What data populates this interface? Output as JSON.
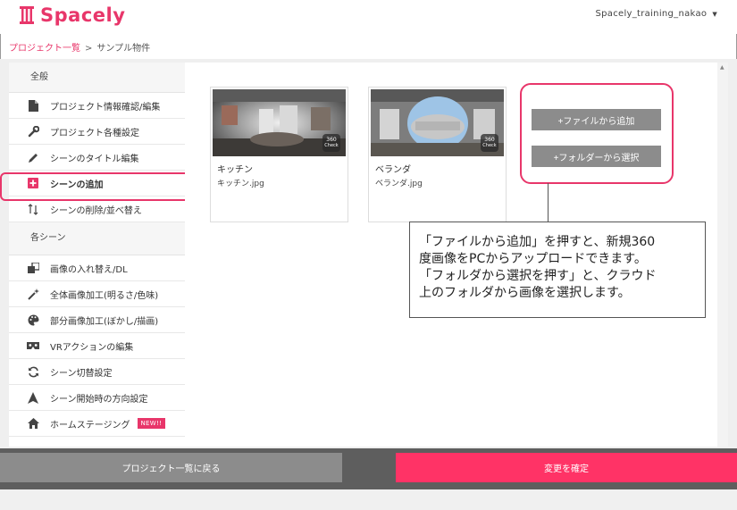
{
  "app": {
    "logo_text": "Spacely",
    "user_name": "Spacely_training_nakao"
  },
  "breadcrumb": {
    "root": "プロジェクト一覧",
    "separator": ">",
    "current": "サンプル物件"
  },
  "sidebar": {
    "general_heading": "全般",
    "general_items": [
      {
        "label": "プロジェクト情報確認/編集",
        "icon": "document-icon"
      },
      {
        "label": "プロジェクト各種設定",
        "icon": "wrench-icon"
      },
      {
        "label": "シーンのタイトル編集",
        "icon": "pencil-icon"
      },
      {
        "label": "シーンの追加",
        "icon": "plus-square-icon"
      },
      {
        "label": "シーンの削除/並べ替え",
        "icon": "sort-arrows-icon"
      }
    ],
    "scene_heading": "各シーン",
    "scene_items": [
      {
        "label": "画像の入れ替え/DL",
        "icon": "image-swap-icon"
      },
      {
        "label": "全体画像加工(明るさ/色味)",
        "icon": "magic-wand-icon"
      },
      {
        "label": "部分画像加工(ぼかし/描画)",
        "icon": "palette-icon"
      },
      {
        "label": "VRアクションの編集",
        "icon": "vr-goggles-icon"
      },
      {
        "label": "シーン切替設定",
        "icon": "refresh-icon"
      },
      {
        "label": "シーン開始時の方向設定",
        "icon": "direction-arrow-icon"
      },
      {
        "label": "ホームステージング",
        "icon": "home-icon",
        "badge": "NEW!!"
      }
    ]
  },
  "scenes": [
    {
      "title": "キッチン",
      "file": "キッチン.jpg",
      "badge_top": "360",
      "badge_bottom": "Check"
    },
    {
      "title": "ベランダ",
      "file": "ベランダ.jpg",
      "badge_top": "360",
      "badge_bottom": "Check"
    }
  ],
  "actions": {
    "add_file": "+ファイルから追加",
    "add_folder": "+フォルダーから選択"
  },
  "callout": {
    "lines": [
      "「ファイルから追加」を押すと、新規360",
      "度画像をPCからアップロードできます。",
      "「フォルダから選択を押す」と、クラウド",
      "上のフォルダから画像を選択します。"
    ]
  },
  "footer": {
    "back_label": "プロジェクト一覧に戻る",
    "confirm_label": "変更を確定"
  },
  "colors": {
    "brand": "#e8366a",
    "confirm": "#ff3366",
    "gray_button": "#8c8c8c"
  }
}
